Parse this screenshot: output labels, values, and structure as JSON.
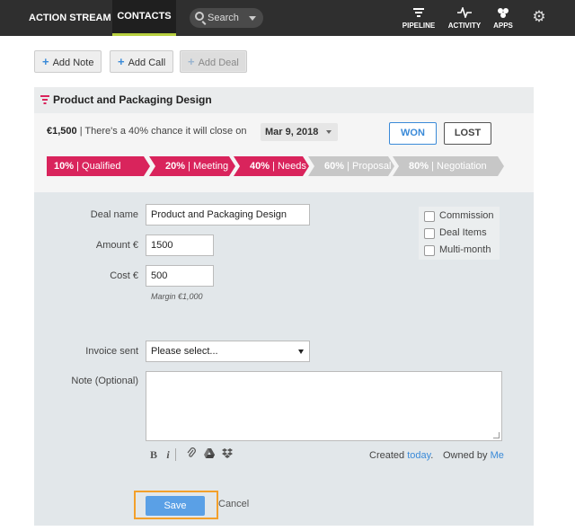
{
  "nav": {
    "action_stream": "ACTION STREAM",
    "contacts": "CONTACTS",
    "search_placeholder": "Search",
    "pipeline": "PIPELINE",
    "activity": "ACTIVITY",
    "apps": "APPS",
    "accent_color": "#b7cf3f"
  },
  "toolbar": {
    "add_note": "Add Note",
    "add_call": "Add Call",
    "add_deal": "Add Deal"
  },
  "deal": {
    "title": "Product and Packaging Design",
    "value": "€1,500",
    "chance_text": "| There's a 40% chance it will close on",
    "close_date": "Mar 9, 2018",
    "won_label": "WON",
    "lost_label": "LOST",
    "stages": [
      {
        "pct": "10%",
        "name": "Qualified",
        "active": true
      },
      {
        "pct": "20%",
        "name": "Meeting",
        "active": true
      },
      {
        "pct": "40%",
        "name": "Needs",
        "active": true
      },
      {
        "pct": "60%",
        "name": "Proposal",
        "active": false
      },
      {
        "pct": "80%",
        "name": "Negotiation",
        "active": false
      }
    ],
    "stage_active_color": "#d9245c",
    "stage_inactive_color": "#c7c7c7"
  },
  "form": {
    "deal_name_label": "Deal name",
    "deal_name_value": "Product and Packaging Design",
    "amount_label": "Amount €",
    "amount_value": "1500",
    "cost_label": "Cost €",
    "cost_value": "500",
    "margin_text": "Margin €1,000",
    "invoice_label": "Invoice sent",
    "invoice_value": "Please select...",
    "note_label": "Note (Optional)",
    "checkboxes": [
      "Commission",
      "Deal Items",
      "Multi-month"
    ],
    "created_label": "Created",
    "created_value": "today",
    "owned_label": "Owned by",
    "owned_value": "Me",
    "save_label": "Save",
    "cancel_label": "Cancel"
  }
}
